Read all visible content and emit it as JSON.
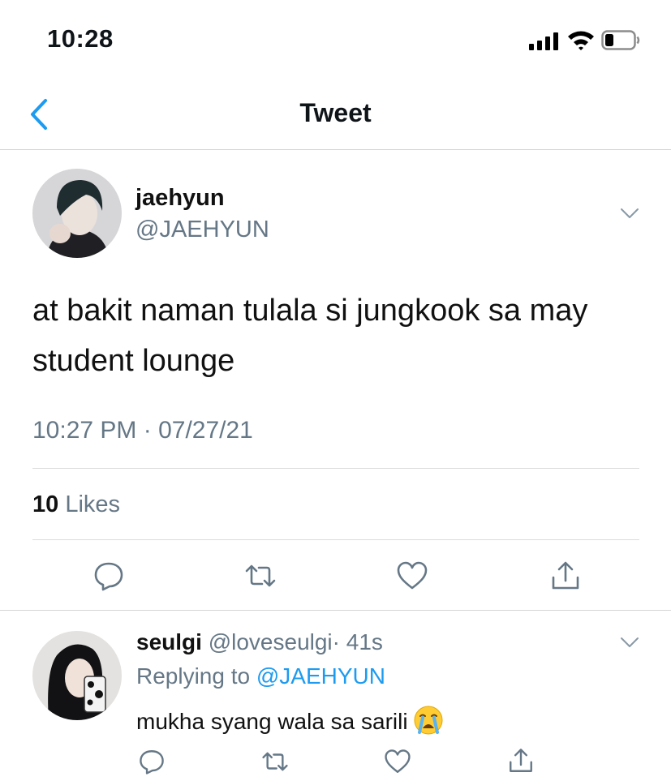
{
  "status_bar": {
    "time": "10:28"
  },
  "nav": {
    "title": "Tweet"
  },
  "tweet": {
    "display_name": "jaehyun",
    "handle": "@JAEHYUN",
    "text": "at bakit naman tulala si jungkook sa may student lounge",
    "timestamp": "10:27 PM · 07/27/21",
    "likes_count": "10",
    "likes_label": "Likes"
  },
  "reply": {
    "display_name": "seulgi",
    "handle": "@loveseulgi",
    "age": "· 41s",
    "replying_prefix": "Replying to",
    "replying_handle": "@JAEHYUN",
    "text": "mukha syang wala sa sarili",
    "emoji": "loudly-crying-face"
  },
  "colors": {
    "accent": "#1d9bf0",
    "muted": "#657786",
    "divider": "#d4d4d4"
  }
}
